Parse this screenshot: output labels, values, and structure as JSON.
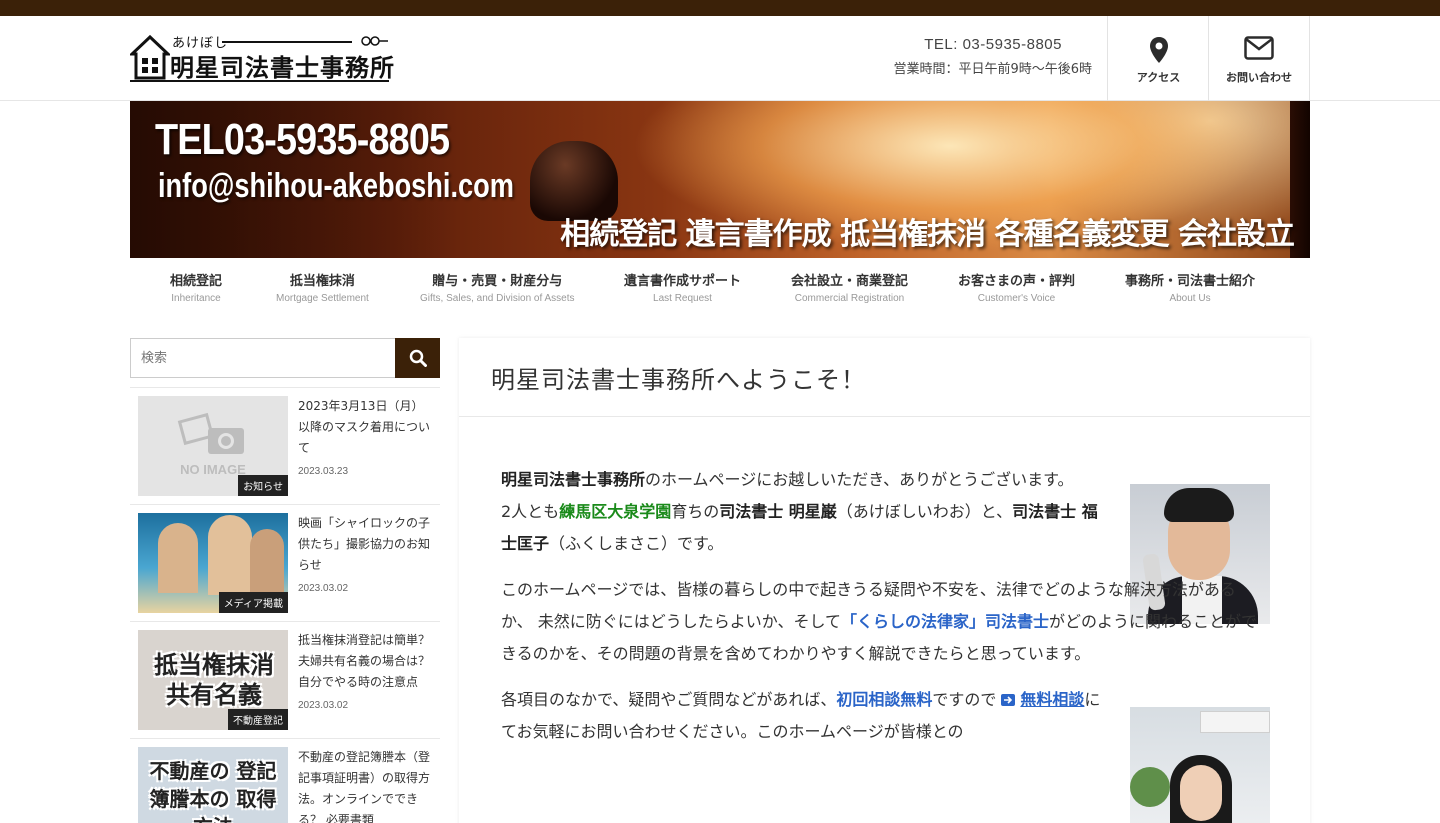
{
  "header": {
    "logo_ruby": "あけぼし",
    "logo_name": "明星司法書士事務所",
    "tel": "TEL: 03-5935-8805",
    "hours": "営業時間：平日午前9時～午後6時",
    "access_label": "アクセス",
    "inquiry_label": "お問い合わせ"
  },
  "banner": {
    "tel": "TEL03-5935-8805",
    "email": "info@shihou-akeboshi.com",
    "services": "相続登記 遺言書作成 抵当権抹消 各種名義変更 会社設立"
  },
  "nav": [
    {
      "jp": "相続登記",
      "en": "Inheritance"
    },
    {
      "jp": "抵当権抹消",
      "en": "Mortgage Settlement"
    },
    {
      "jp": "贈与・売買・財産分与",
      "en": "Gifts, Sales, and Division of Assets"
    },
    {
      "jp": "遺言書作成サポート",
      "en": "Last Request"
    },
    {
      "jp": "会社設立・商業登記",
      "en": "Commercial Registration"
    },
    {
      "jp": "お客さまの声・評判",
      "en": "Customer's Voice"
    },
    {
      "jp": "事務所・司法書士紹介",
      "en": "About Us"
    }
  ],
  "sidebar": {
    "search_placeholder": "検索",
    "posts": [
      {
        "title": "2023年3月13日（月）以降のマスク着用について",
        "date": "2023.03.23",
        "category": "お知らせ",
        "thumb_text": "NO IMAGE"
      },
      {
        "title": "映画「シャイロックの子供たち」撮影協力のお知らせ",
        "date": "2023.03.02",
        "category": "メディア掲載",
        "thumb_text": ""
      },
      {
        "title": "抵当権抹消登記は簡単？ 夫婦共有名義の場合は？ 自分でやる時の注意点",
        "date": "2023.03.02",
        "category": "不動産登記",
        "thumb_text": "抵当権抹消 共有名義"
      },
      {
        "title": "不動産の登記簿謄本（登記事項証明書）の取得方法。オンラインでできる？ 必要書類",
        "date": "",
        "category": "",
        "thumb_text": "不動産の 登記簿謄本の 取得方法"
      }
    ]
  },
  "main": {
    "page_title": "明星司法書士事務所へようこそ！",
    "p1_b1": "明星司法書士事務所",
    "p1_t1": "のホームページにお越しいただき、ありがとうございます。",
    "p1_t2": "2人とも",
    "p1_place": "練馬区大泉学園",
    "p1_t3": "育ちの",
    "p1_b2": "司法書士 明星巌",
    "p1_t4": "（あけぼしいわお）と、",
    "p1_b3": "司法書士 福士匡子",
    "p1_t5": "（ふくしまさこ）です。",
    "p2_t1": "このホームページでは、皆様の暮らしの中で起きうる疑問や不安を、法律でどのような解決方法があるか、 未然に防ぐにはどうしたらよいか、そして",
    "p2_link": "「くらしの法律家」司法書士",
    "p2_t2": "がどのように関わることができるのかを、その問題の背景を含めてわかりやすく解説できたらと思っています。",
    "p3_t1": "各項目のなかで、疑問やご質問などがあれば、",
    "p3_blue": "初回相談無料",
    "p3_t2": "ですので",
    "p3_link": "無料相談",
    "p3_t3": "にてお気軽にお問い合わせください。このホームページが皆様との"
  },
  "colors": {
    "topbar": "#3b2108",
    "search_button": "#3b2108",
    "green_text": "#1a8a1a",
    "link_blue": "#2a64c8"
  }
}
